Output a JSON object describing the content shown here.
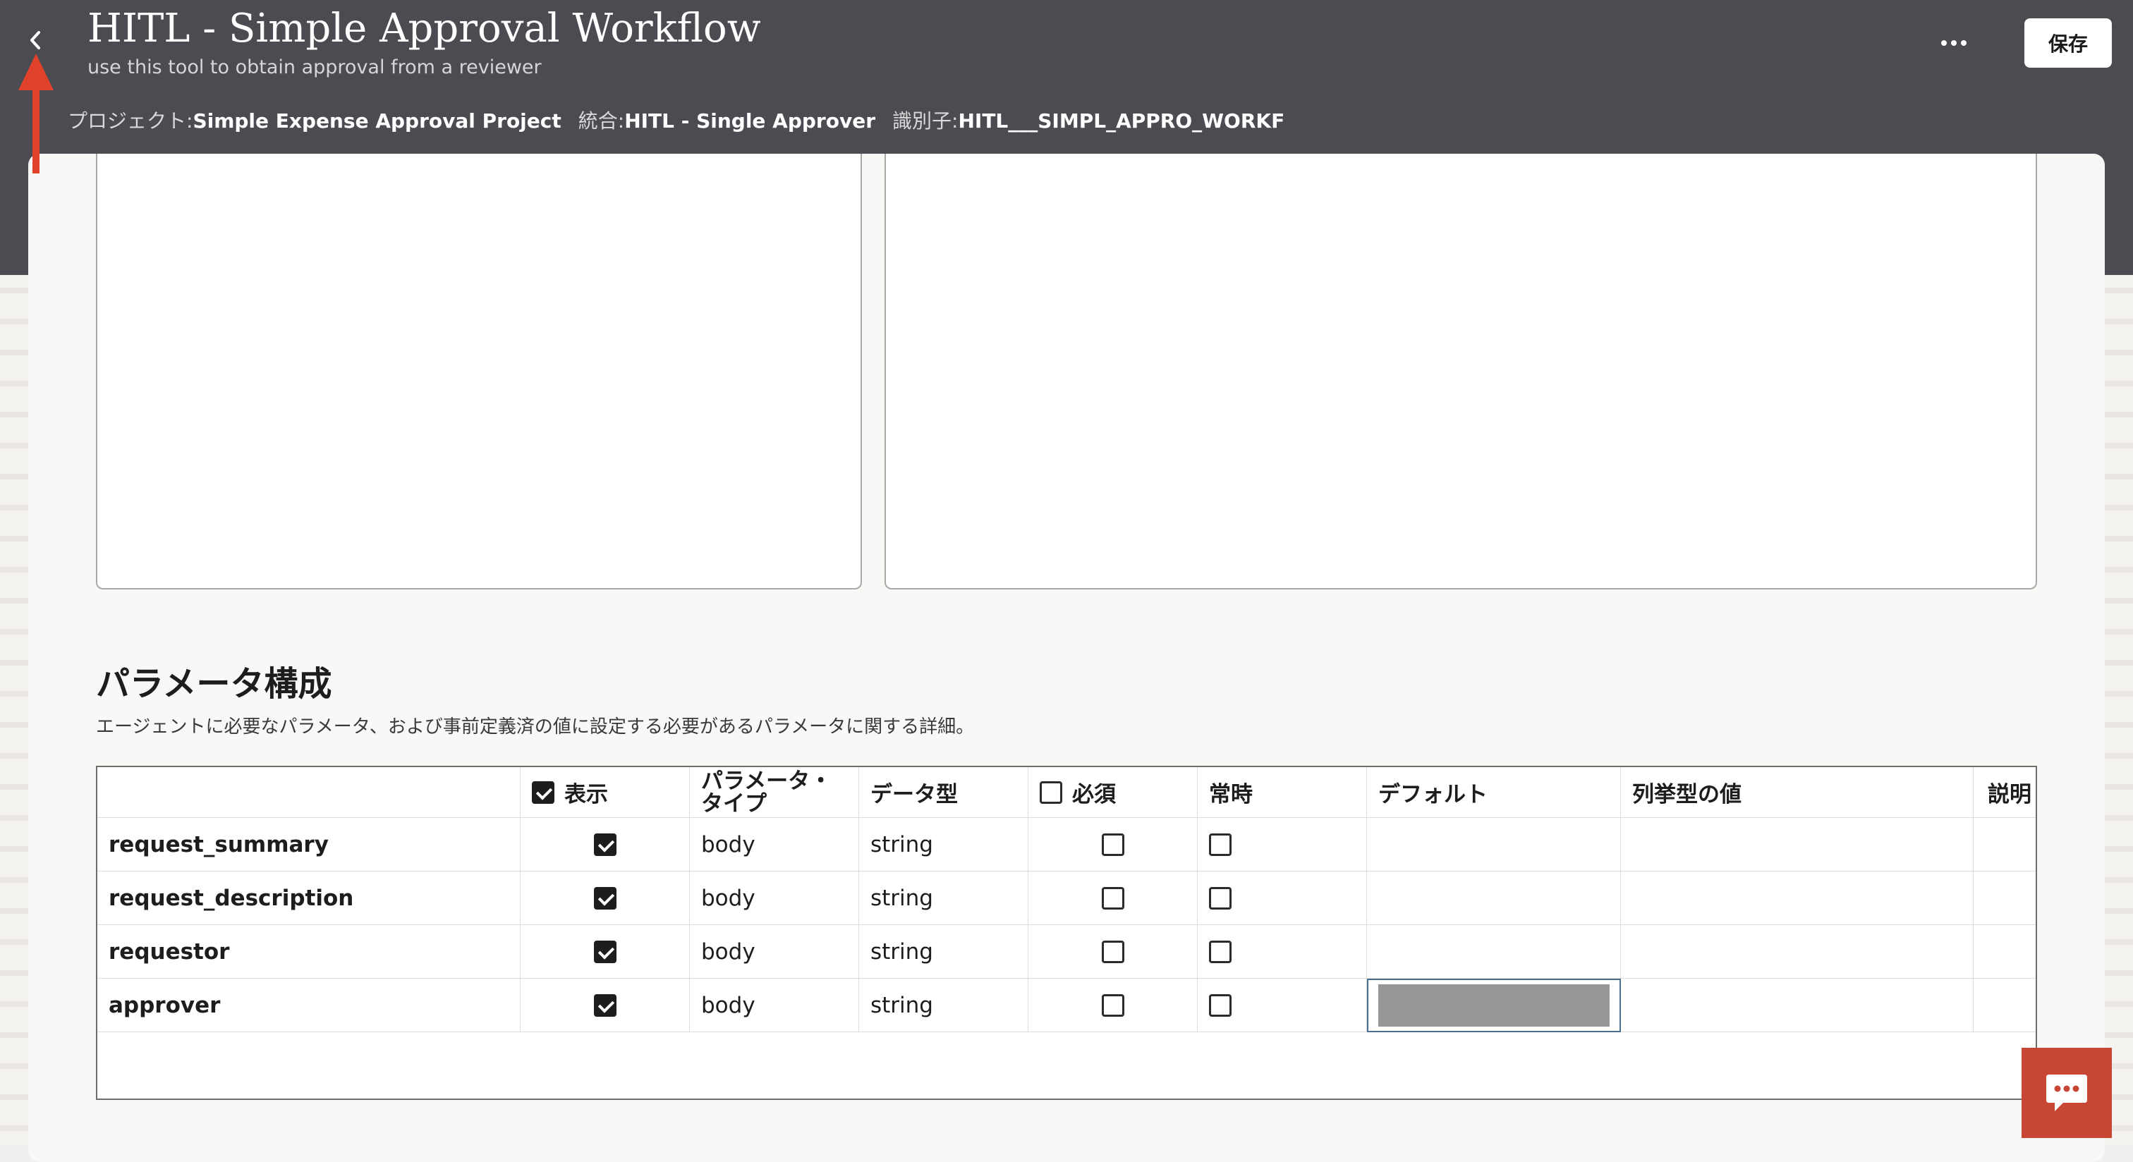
{
  "header": {
    "title": "HITL - Simple Approval Workflow",
    "subtitle": "use this tool to obtain approval from a reviewer",
    "project_label": "プロジェクト:",
    "project_value": "Simple Expense Approval Project",
    "integration_label": "統合:",
    "integration_value": "HITL - Single Approver",
    "identifier_label": "識別子:",
    "identifier_value": "HITL___SIMPL_APPRO_WORKF",
    "save_label": "保存",
    "icons": {
      "back": "chevron-left-icon",
      "more": "more-horizontal-icon"
    }
  },
  "section": {
    "title": "パラメータ構成",
    "description": "エージェントに必要なパラメータ、および事前定義済の値に設定する必要があるパラメータに関する詳細。"
  },
  "table": {
    "columns": {
      "display": "表示",
      "param_type_line1": "パラメータ・",
      "param_type_line2": "タイプ",
      "data_type": "データ型",
      "required": "必須",
      "always": "常時",
      "default": "デフォルト",
      "enum_values": "列挙型の値",
      "description": "説明"
    },
    "header_display_checked": true,
    "header_required_checked": false,
    "rows": [
      {
        "name": "request_summary",
        "display": true,
        "param_type": "body",
        "data_type": "string",
        "required": false,
        "always": false
      },
      {
        "name": "request_description",
        "display": true,
        "param_type": "body",
        "data_type": "string",
        "required": false,
        "always": false
      },
      {
        "name": "requestor",
        "display": true,
        "param_type": "body",
        "data_type": "string",
        "required": false,
        "always": false
      },
      {
        "name": "approver",
        "display": true,
        "param_type": "body",
        "data_type": "string",
        "required": false,
        "always": false
      }
    ]
  },
  "chat": {
    "icon": "chat-bubble-icon",
    "color": "#c74634"
  },
  "colors": {
    "header_bg": "#4a4c51",
    "annotation_arrow": "#e0412b"
  }
}
